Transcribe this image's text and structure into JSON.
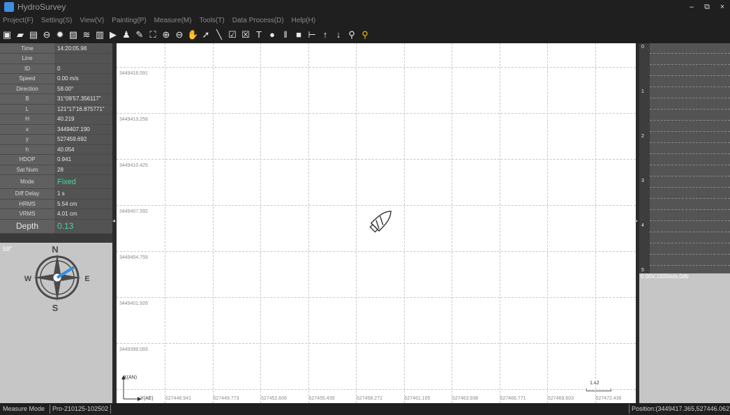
{
  "app": {
    "title": "HydroSurvey",
    "window_controls": [
      "–",
      "⧉",
      "×"
    ]
  },
  "menu": [
    "Project(F)",
    "Setting(S)",
    "View(V)",
    "Painting(P)",
    "Measure(M)",
    "Tools(T)",
    "Data Process(D)",
    "Help(H)"
  ],
  "toolbar_icons": [
    "new-project-icon",
    "open-project-icon",
    "save-icon",
    "link-icon",
    "settings-icon",
    "image-icon",
    "waves-icon",
    "document-icon",
    "record-icon",
    "survey-person-icon",
    "edit-box-icon",
    "fit-view-icon",
    "zoom-in-icon",
    "zoom-out-icon",
    "pan-hand-icon",
    "select-arrow-icon",
    "draw-line-icon",
    "edit-check-icon",
    "edit-box-2-icon",
    "text-tool-icon",
    "point-icon",
    "pause-icon",
    "stop-icon",
    "measure-width-icon",
    "arrow-up-icon",
    "arrow-down-icon",
    "pin-icon",
    "pin-accent-icon"
  ],
  "info": {
    "rows": [
      {
        "key": "Time",
        "value": "14:20:05.98"
      },
      {
        "key": "Line",
        "value": ""
      },
      {
        "key": "ID",
        "value": "0"
      },
      {
        "key": "Speed",
        "value": "0.00 m/s"
      },
      {
        "key": "Direction",
        "value": "58.00°"
      },
      {
        "key": "B",
        "value": "31°09'57.356117\""
      },
      {
        "key": "L",
        "value": "121°17'16.875771\""
      },
      {
        "key": "H",
        "value": "40.219"
      },
      {
        "key": "x",
        "value": "3449407.190"
      },
      {
        "key": "y",
        "value": "527459.692"
      },
      {
        "key": "h",
        "value": "40.054"
      },
      {
        "key": "HDOP",
        "value": "0.941"
      },
      {
        "key": "Sat Num",
        "value": "28"
      },
      {
        "key": "Mode",
        "value": "Fixed"
      },
      {
        "key": "Diff Delay",
        "value": "1 s"
      },
      {
        "key": "HRMS",
        "value": "5.54 cm"
      },
      {
        "key": "VRMS",
        "value": "4.01 cm"
      },
      {
        "key": "Depth",
        "value": "0.13"
      }
    ]
  },
  "compass": {
    "heading_label": "58°",
    "heading": 58,
    "N": "N",
    "S": "S",
    "E": "E",
    "W": "W"
  },
  "map": {
    "y_labels": [
      "3449416.091",
      "3449413.258",
      "3449410.425",
      "3449407.592",
      "3449404.759",
      "3449401.926",
      "3449399.093"
    ],
    "x_labels": [
      "527446.941",
      "527449.773",
      "527452.606",
      "527455.439",
      "527458.272",
      "527461.105",
      "527463.938",
      "527466.771",
      "527469.603",
      "527472.436"
    ],
    "axis_north": "X(AN)",
    "axis_east": "Y(AE)",
    "scale_value": "1.42"
  },
  "echo": {
    "ticks": [
      "0",
      "1",
      "2",
      "3",
      "4",
      "5"
    ],
    "status": "0.00V,1500m/s,0db"
  },
  "status": {
    "mode": "Measure Mode",
    "project": "Pro-210125-102502",
    "position": "Position:(3449417.365,527446.062)"
  },
  "colors": {
    "accent_green": "#4fd39a",
    "compass_needle": "#2f8fe0",
    "toolbar_accent": "#f2c200"
  }
}
